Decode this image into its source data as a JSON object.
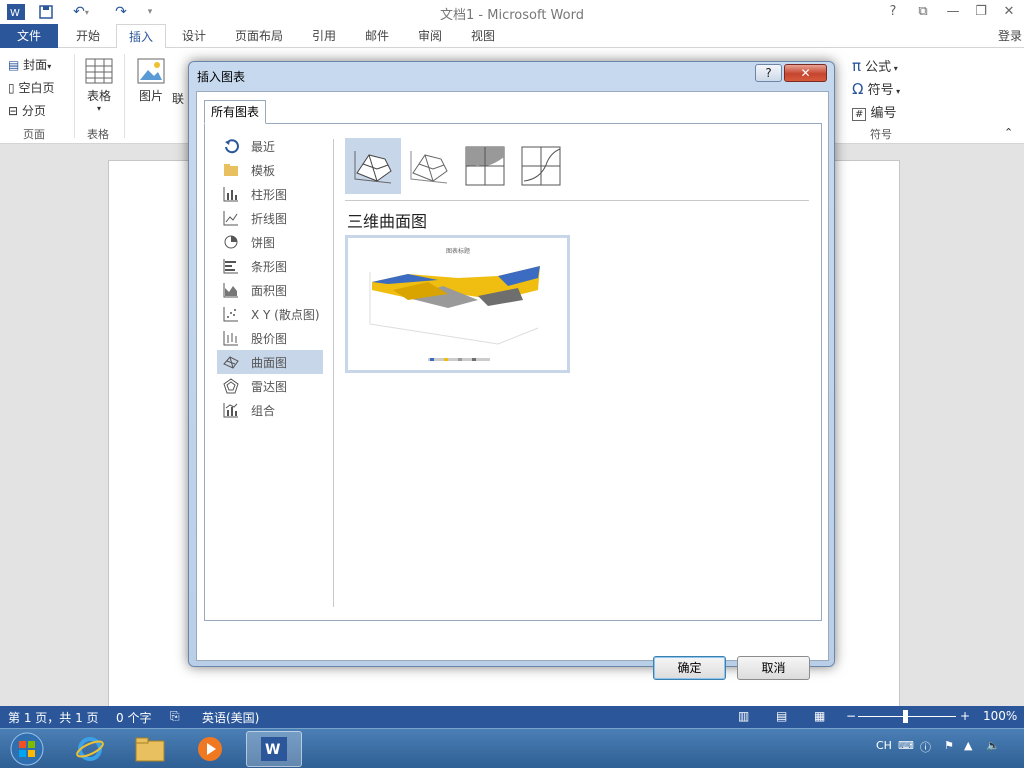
{
  "window": {
    "title": "文档1 - Microsoft Word",
    "login": "登录"
  },
  "tabs": [
    {
      "label": "文件"
    },
    {
      "label": "开始"
    },
    {
      "label": "插入"
    },
    {
      "label": "设计"
    },
    {
      "label": "页面布局"
    },
    {
      "label": "引用"
    },
    {
      "label": "邮件"
    },
    {
      "label": "审阅"
    },
    {
      "label": "视图"
    }
  ],
  "ribbon": {
    "cover": "封面",
    "blank_page": "空白页",
    "page_break": "分页",
    "group_pages": "页面",
    "table": "表格",
    "group_table": "表格",
    "picture": "图片",
    "online": "联",
    "equation": "公式",
    "symbol": "符号",
    "number": "编号",
    "group_symbols": "符号"
  },
  "dialog": {
    "title": "插入图表",
    "help": "?",
    "close": "✕",
    "tab": "所有图表",
    "categories": [
      {
        "label": "最近",
        "icon": "recent-icon"
      },
      {
        "label": "模板",
        "icon": "folder-icon"
      },
      {
        "label": "柱形图",
        "icon": "column-chart-icon"
      },
      {
        "label": "折线图",
        "icon": "line-chart-icon"
      },
      {
        "label": "饼图",
        "icon": "pie-chart-icon"
      },
      {
        "label": "条形图",
        "icon": "bar-chart-icon"
      },
      {
        "label": "面积图",
        "icon": "area-chart-icon"
      },
      {
        "label": "X Y (散点图)",
        "icon": "scatter-chart-icon"
      },
      {
        "label": "股价图",
        "icon": "stock-chart-icon"
      },
      {
        "label": "曲面图",
        "icon": "surface-chart-icon"
      },
      {
        "label": "雷达图",
        "icon": "radar-chart-icon"
      },
      {
        "label": "组合",
        "icon": "combo-chart-icon"
      }
    ],
    "selected_category": 9,
    "subtype_title": "三维曲面图",
    "preview": {
      "title": "图表标题"
    },
    "ok": "确定",
    "cancel": "取消"
  },
  "status": {
    "page": "第 1 页，共 1 页",
    "words": "0 个字",
    "lang": "英语(美国)",
    "zoom": "100%"
  },
  "tray": {
    "lang": "CH"
  },
  "colors": {
    "accent": "#2b579a",
    "selection": "#c8d6ea"
  }
}
